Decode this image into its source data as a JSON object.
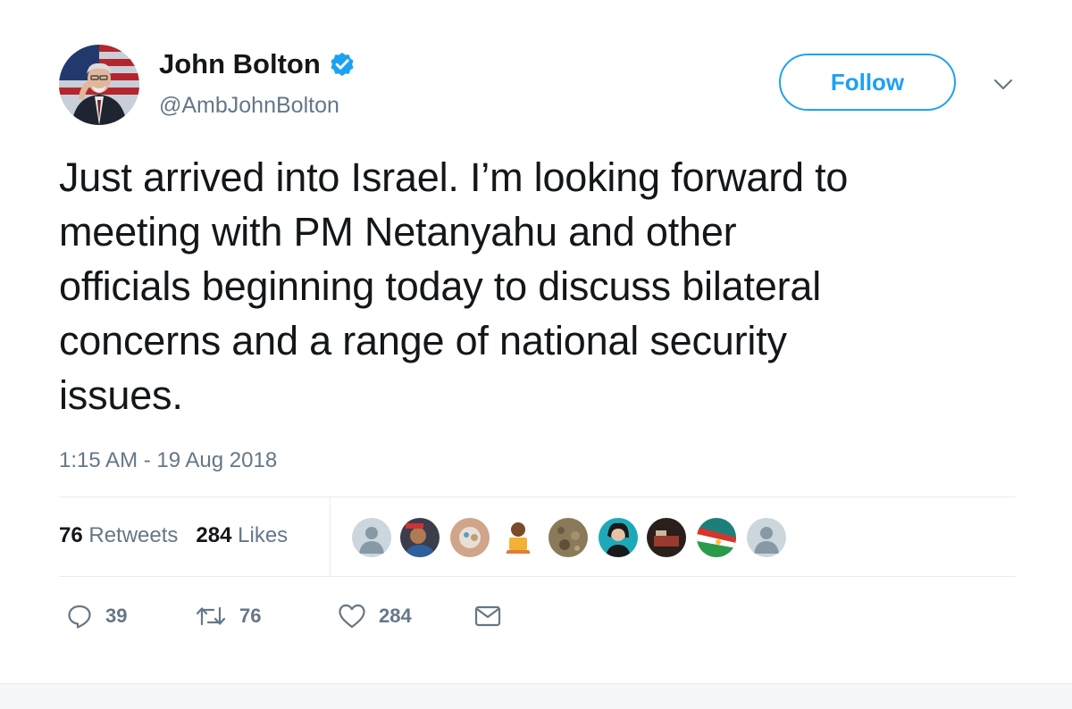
{
  "user": {
    "name": "John Bolton",
    "handle": "@AmbJohnBolton",
    "verified": true
  },
  "follow_label": "Follow",
  "tweet": {
    "lines": [
      "Just arrived into Israel. I’m looking forward to",
      "meeting with PM Netanyahu and other",
      "officials beginning today to discuss bilateral",
      "concerns and a range of national security",
      "issues."
    ],
    "timestamp": "1:15 AM - 19 Aug 2018"
  },
  "stats": {
    "retweets_count": "76",
    "retweets_label": "Retweets",
    "likes_count": "284",
    "likes_label": "Likes"
  },
  "likers": [
    "default-avatar",
    "photo-avatar",
    "photo-avatar",
    "cartoon-avatar",
    "photo-avatar",
    "photo-avatar",
    "photo-avatar",
    "flag-avatar",
    "default-avatar"
  ],
  "actions": {
    "reply_count": "39",
    "retweet_count": "76",
    "like_count": "284"
  },
  "colors": {
    "accent": "#1da1f2",
    "text": "#14171a",
    "muted": "#657786",
    "divider": "#e6ecf0"
  }
}
